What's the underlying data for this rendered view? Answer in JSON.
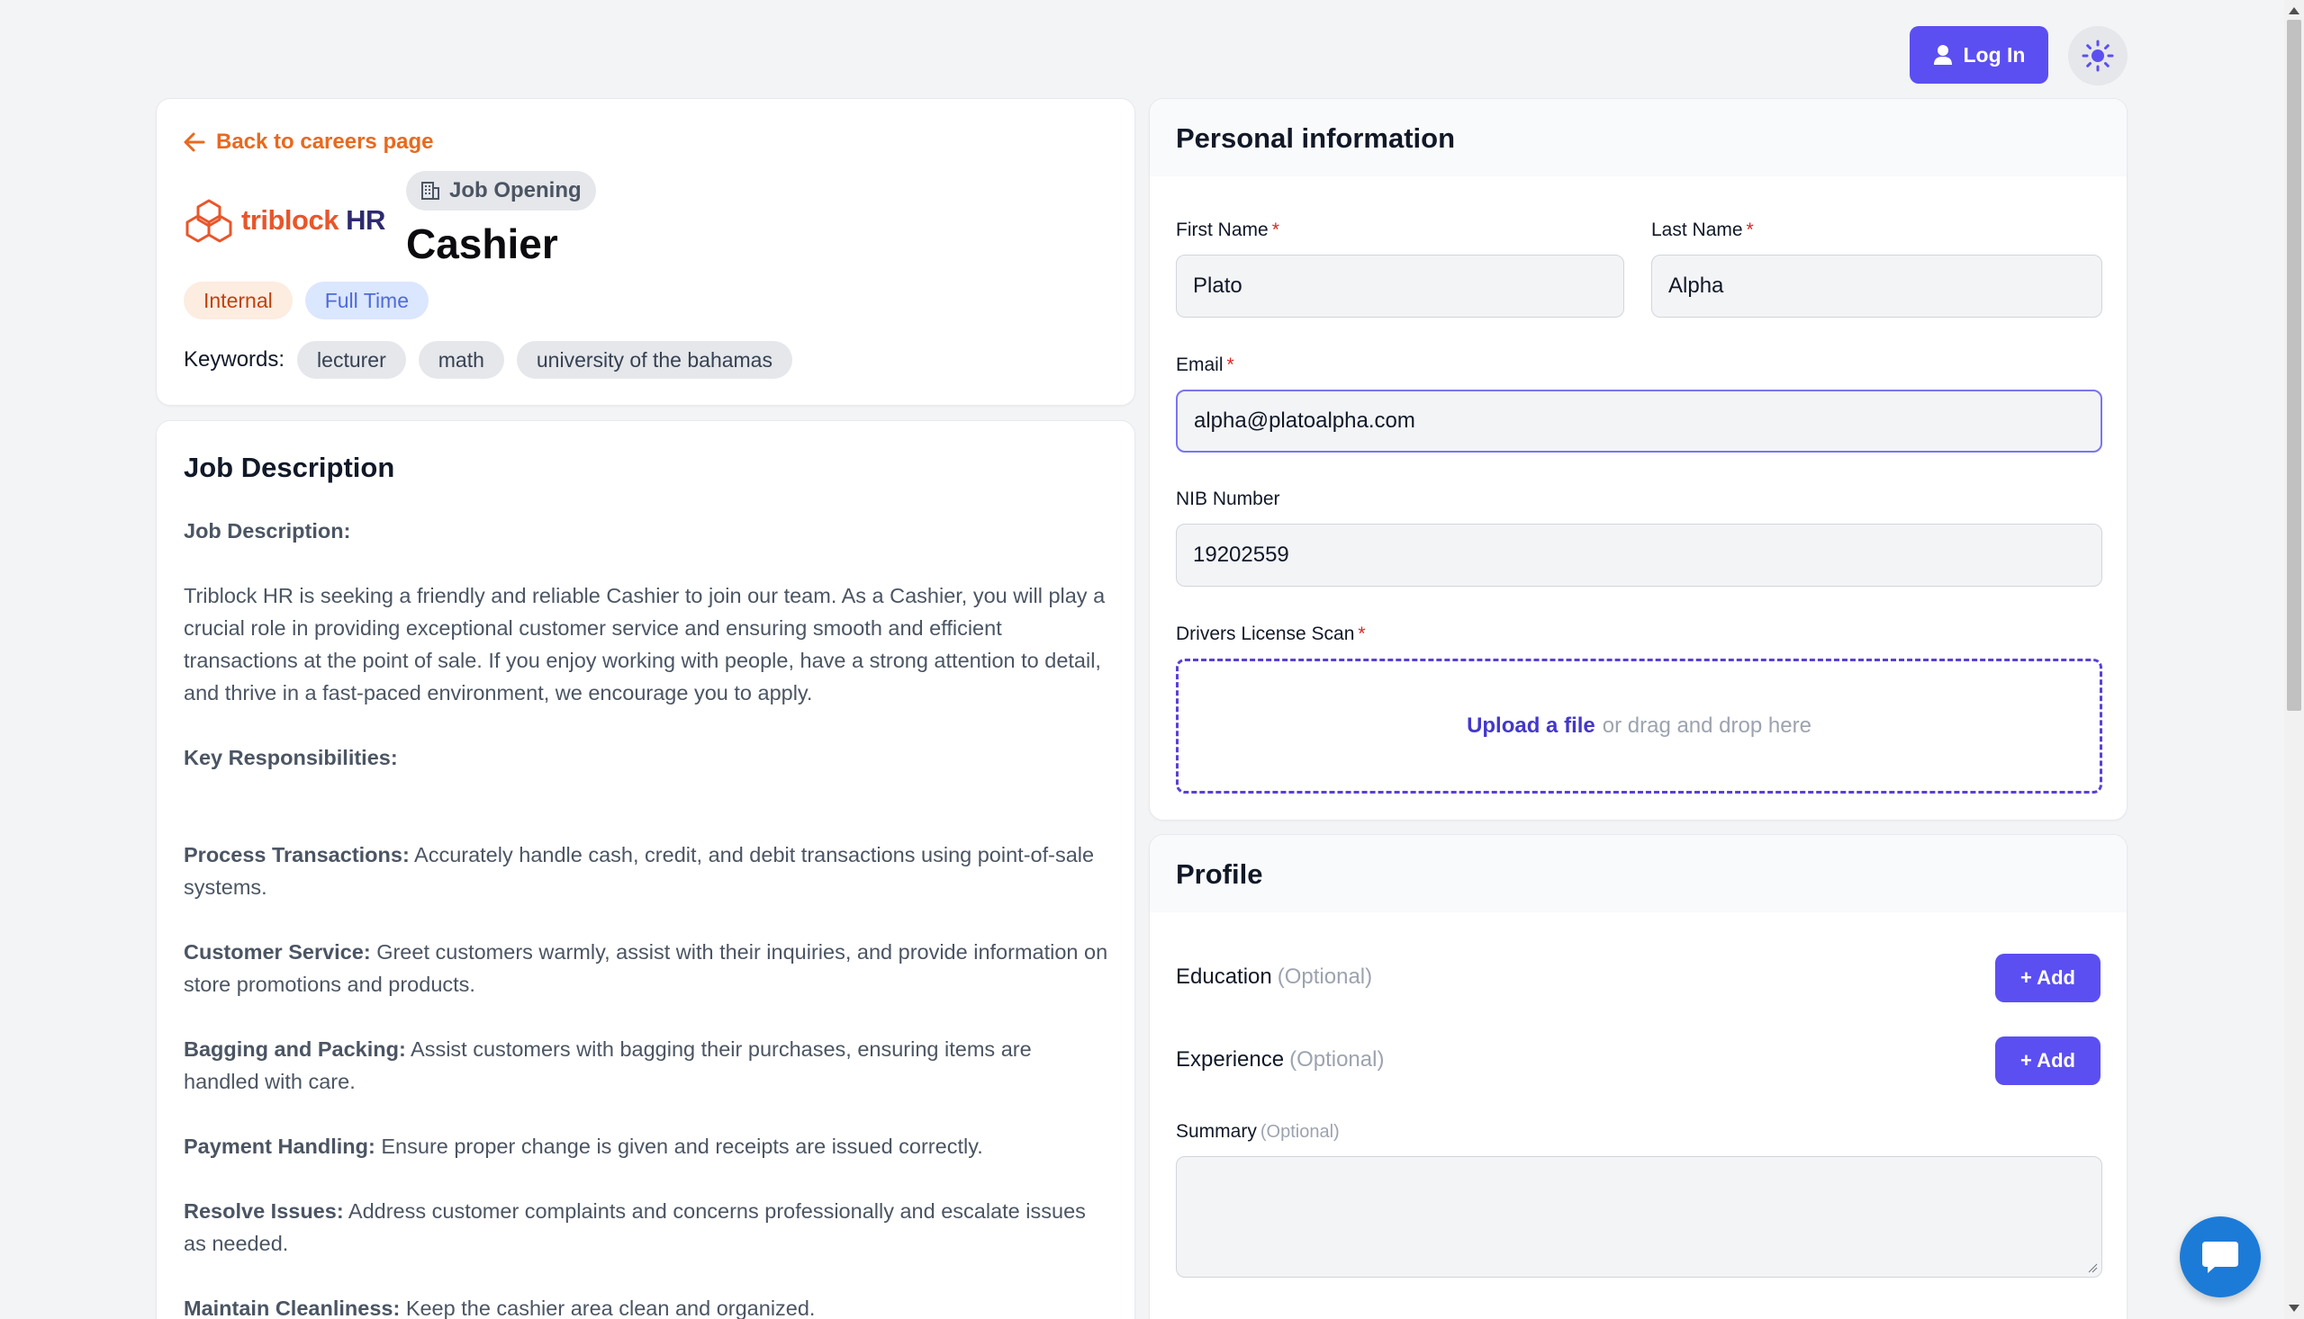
{
  "header": {
    "login_label": "Log In",
    "login_icon": "user-icon",
    "theme_icon": "sun-icon"
  },
  "job": {
    "back_label": "Back to careers page",
    "company_name": "triblock",
    "company_suffix": "HR",
    "opening_label": "Job Opening",
    "title": "Cashier",
    "tags": [
      "Internal",
      "Full Time"
    ],
    "keywords_label": "Keywords:",
    "keywords": [
      "lecturer",
      "math",
      "university of the bahamas"
    ]
  },
  "description": {
    "heading": "Job Description",
    "sub_heading": "Job Description:",
    "intro": "Triblock HR is seeking a friendly and reliable Cashier to join our team. As a Cashier, you will play a crucial role in providing exceptional customer service and ensuring smooth and efficient transactions at the point of sale. If you enjoy working with people, have a strong attention to detail, and thrive in a fast-paced environment, we encourage you to apply.",
    "responsibilities_heading": "Key Responsibilities:",
    "responsibilities": [
      {
        "title": "Process Transactions:",
        "text": "Accurately handle cash, credit, and debit transactions using point-of-sale systems."
      },
      {
        "title": "Customer Service:",
        "text": "Greet customers warmly, assist with their inquiries, and provide information on store promotions and products."
      },
      {
        "title": "Bagging and Packing:",
        "text": "Assist customers with bagging their purchases, ensuring items are handled with care."
      },
      {
        "title": "Payment Handling:",
        "text": "Ensure proper change is given and receipts are issued correctly."
      },
      {
        "title": "Resolve Issues:",
        "text": "Address customer complaints and concerns professionally and escalate issues as needed."
      },
      {
        "title": "Maintain Cleanliness:",
        "text": "Keep the cashier area clean and organized."
      }
    ]
  },
  "personal": {
    "heading": "Personal information",
    "first_name_label": "First Name",
    "first_name_value": "Plato",
    "last_name_label": "Last Name",
    "last_name_value": "Alpha",
    "email_label": "Email",
    "email_value": "alpha@platoalpha.com",
    "nib_label": "NIB Number",
    "nib_value": "19202559",
    "license_label": "Drivers License Scan",
    "upload_link": "Upload a file",
    "upload_hint": "or drag and drop here",
    "required_mark": "*"
  },
  "profile": {
    "heading": "Profile",
    "education_label": "Education",
    "experience_label": "Experience",
    "summary_label": "Summary",
    "optional_label": "(Optional)",
    "add_label": "+ Add"
  },
  "colors": {
    "accent": "#5b4ff2",
    "orange": "#e8691f",
    "required": "#dc2626"
  }
}
